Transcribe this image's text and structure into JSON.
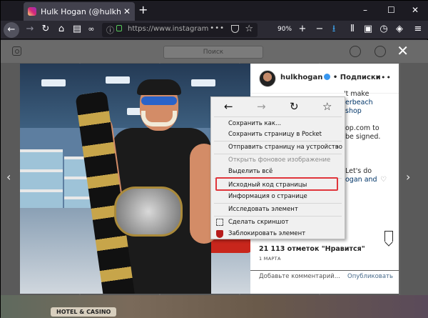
{
  "browser": {
    "tab_title": "Hulk Hogan (@hulkhogan) • Ф",
    "tab_close": "✕",
    "new_tab": "+",
    "url_text": "https://www.instagram",
    "zoom": "90%",
    "window_controls": {
      "minimize": "–",
      "maximize": "☐",
      "close": "✕"
    }
  },
  "instagram": {
    "search_placeholder": "Поиск",
    "overlay_close": "✕",
    "background_sign": "HOTEL & CASINO",
    "post": {
      "username": "hulkhogan",
      "follow_label": "• Подписки",
      "more": "•••",
      "caption_lines": [
        "'t make",
        "erbeach",
        "shop",
        "op.com to",
        "be signed.",
        "Let's do",
        "ogan and"
      ],
      "likes": "21 113 отметок \"Нравится\"",
      "date": "1 МАРТА",
      "comment_placeholder": "Добавьте комментарий...",
      "publish_label": "Опубликовать"
    }
  },
  "context_menu": {
    "items": [
      {
        "label": "Сохранить как...",
        "disabled": false
      },
      {
        "label": "Сохранить страницу в Pocket",
        "disabled": false
      },
      {
        "label": "Отправить страницу на устройство",
        "disabled": false,
        "submenu": true
      },
      {
        "label": "Открыть фоновое изображение",
        "disabled": true
      },
      {
        "label": "Выделить всё",
        "disabled": false
      },
      {
        "label": "Исходный код страницы",
        "disabled": false,
        "highlighted": true
      },
      {
        "label": "Информация о странице",
        "disabled": false
      },
      {
        "label": "Исследовать элемент",
        "disabled": false
      },
      {
        "label": "Сделать скриншот",
        "disabled": false
      },
      {
        "label": "Заблокировать элемент",
        "disabled": false
      }
    ],
    "submenu_arrow": "›"
  },
  "colors": {
    "highlight_border": "#e0353b",
    "accent_link": "#003569"
  }
}
